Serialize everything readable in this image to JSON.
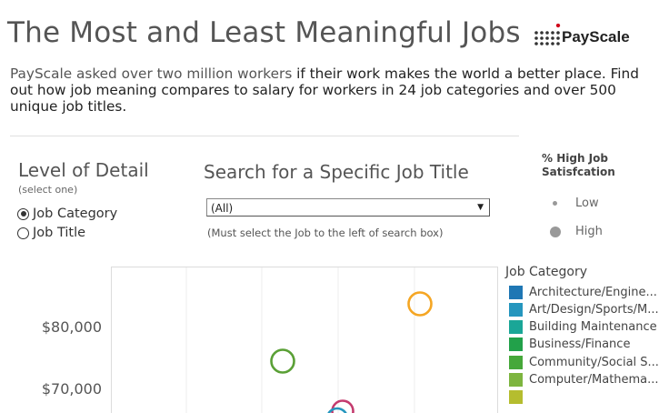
{
  "header": {
    "title": "The Most and Least Meaningful Jobs",
    "brand": "PayScale"
  },
  "intro": {
    "part1": "PayScale asked over two million workers",
    "part2": " if their work makes the world a better place. Find out how job meaning compares to salary for workers in 24 job categories and over 500 unique job titles."
  },
  "level_of_detail": {
    "title": "Level of Detail",
    "subtitle": "(select one)",
    "options": [
      {
        "label": "Job Category",
        "checked": true
      },
      {
        "label": "Job Title",
        "checked": false
      }
    ]
  },
  "search": {
    "title": "Search for a Specific Job Title",
    "selected_value": "(All)",
    "note": "(Must select the Job to the left of search box)"
  },
  "satisfaction_legend": {
    "title_line1": "% High Job",
    "title_line2": "Satisfcation",
    "items": [
      "Low",
      "High"
    ]
  },
  "job_category_legend": {
    "title": "Job Category",
    "items": [
      {
        "label": "Architecture/Engine...",
        "color": "#1f77b4"
      },
      {
        "label": "Art/Design/Sports/M...",
        "color": "#2596be"
      },
      {
        "label": "Building Maintenance",
        "color": "#1aa697"
      },
      {
        "label": "Business/Finance",
        "color": "#22a14a"
      },
      {
        "label": "Community/Social S...",
        "color": "#46a83a"
      },
      {
        "label": "Computer/Mathema...",
        "color": "#7db53f"
      }
    ]
  },
  "chart_data": {
    "type": "scatter",
    "y_ticks": [
      {
        "value": 80000,
        "label": "$80,000"
      },
      {
        "value": 70000,
        "label": "$70,000"
      }
    ],
    "points": [
      {
        "category": "Computer/Mathema...",
        "color": "#f5a623"
      },
      {
        "category": "Business/Finance",
        "color": "#5aa036"
      },
      {
        "category": "Architecture/Engine...",
        "color": "#c43b6e"
      },
      {
        "category": "Art/Design/Sports/M...",
        "color": "#2596be"
      }
    ]
  }
}
